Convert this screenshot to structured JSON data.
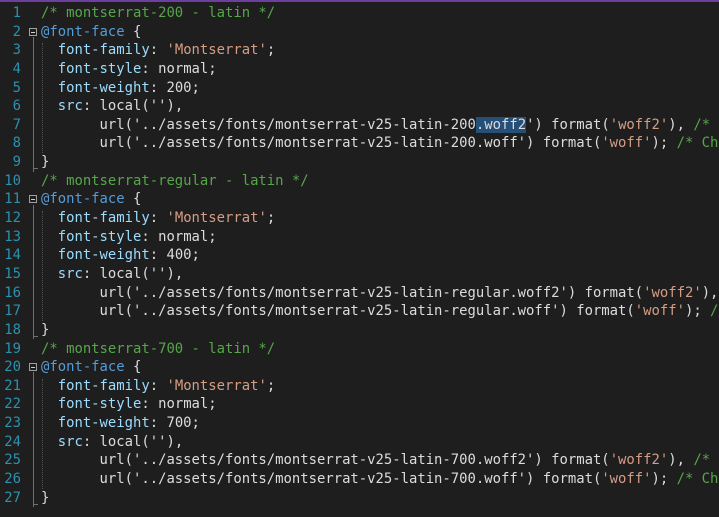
{
  "editor": {
    "accent_color": "#6c3f9e",
    "lines": [
      {
        "n": "1",
        "tokens": [
          [
            "c",
            "/* montserrat-200 - latin */"
          ]
        ]
      },
      {
        "n": "2",
        "fold": true,
        "tokens": [
          [
            "k",
            "@font-face"
          ],
          [
            "t",
            " {"
          ]
        ]
      },
      {
        "n": "3",
        "tokens": [
          [
            "t",
            "  "
          ],
          [
            "p",
            "font-family"
          ],
          [
            "t",
            ": "
          ],
          [
            "s",
            "'Montserrat'"
          ],
          [
            "t",
            ";"
          ]
        ]
      },
      {
        "n": "4",
        "tokens": [
          [
            "t",
            "  "
          ],
          [
            "p",
            "font-style"
          ],
          [
            "t",
            ": normal;"
          ]
        ]
      },
      {
        "n": "5",
        "tokens": [
          [
            "t",
            "  "
          ],
          [
            "p",
            "font-weight"
          ],
          [
            "t",
            ": 200;"
          ]
        ]
      },
      {
        "n": "6",
        "tokens": [
          [
            "t",
            "  "
          ],
          [
            "p",
            "src"
          ],
          [
            "t",
            ": local('"
          ],
          [
            "t",
            "'),"
          ]
        ]
      },
      {
        "n": "7",
        "tokens": [
          [
            "t",
            "       url('../assets/fonts/montserrat-v25-latin-200"
          ],
          [
            "caret",
            ""
          ],
          [
            "sel",
            ".woff2"
          ],
          [
            "t",
            "') format("
          ],
          [
            "s",
            "'woff2'"
          ],
          [
            "t",
            "), "
          ],
          [
            "c",
            "/*"
          ]
        ]
      },
      {
        "n": "8",
        "tokens": [
          [
            "t",
            "       url('../assets/fonts/montserrat-v25-latin-200.woff') format("
          ],
          [
            "s",
            "'woff'"
          ],
          [
            "t",
            "); "
          ],
          [
            "c",
            "/* Ch"
          ]
        ]
      },
      {
        "n": "9",
        "tokens": [
          [
            "t",
            "}"
          ]
        ]
      },
      {
        "n": "10",
        "tokens": [
          [
            "c",
            "/* montserrat-regular - latin */"
          ]
        ]
      },
      {
        "n": "11",
        "fold": true,
        "tokens": [
          [
            "k",
            "@font-face"
          ],
          [
            "t",
            " {"
          ]
        ]
      },
      {
        "n": "12",
        "tokens": [
          [
            "t",
            "  "
          ],
          [
            "p",
            "font-family"
          ],
          [
            "t",
            ": "
          ],
          [
            "s",
            "'Montserrat'"
          ],
          [
            "t",
            ";"
          ]
        ]
      },
      {
        "n": "13",
        "tokens": [
          [
            "t",
            "  "
          ],
          [
            "p",
            "font-style"
          ],
          [
            "t",
            ": normal;"
          ]
        ]
      },
      {
        "n": "14",
        "tokens": [
          [
            "t",
            "  "
          ],
          [
            "p",
            "font-weight"
          ],
          [
            "t",
            ": 400;"
          ]
        ]
      },
      {
        "n": "15",
        "tokens": [
          [
            "t",
            "  "
          ],
          [
            "p",
            "src"
          ],
          [
            "t",
            ": local('"
          ],
          [
            "t",
            "'),"
          ]
        ]
      },
      {
        "n": "16",
        "tokens": [
          [
            "t",
            "       url('../assets/fonts/montserrat-v25-latin-regular.woff2') format("
          ],
          [
            "s",
            "'woff2'"
          ],
          [
            "t",
            "),"
          ]
        ]
      },
      {
        "n": "17",
        "tokens": [
          [
            "t",
            "       url('../assets/fonts/montserrat-v25-latin-regular.woff') format("
          ],
          [
            "s",
            "'woff'"
          ],
          [
            "t",
            "); "
          ],
          [
            "c",
            "/"
          ]
        ]
      },
      {
        "n": "18",
        "tokens": [
          [
            "t",
            "}"
          ]
        ]
      },
      {
        "n": "19",
        "tokens": [
          [
            "c",
            "/* montserrat-700 - latin */"
          ]
        ]
      },
      {
        "n": "20",
        "fold": true,
        "tokens": [
          [
            "k",
            "@font-face"
          ],
          [
            "t",
            " {"
          ]
        ]
      },
      {
        "n": "21",
        "tokens": [
          [
            "t",
            "  "
          ],
          [
            "p",
            "font-family"
          ],
          [
            "t",
            ": "
          ],
          [
            "s",
            "'Montserrat'"
          ],
          [
            "t",
            ";"
          ]
        ]
      },
      {
        "n": "22",
        "tokens": [
          [
            "t",
            "  "
          ],
          [
            "p",
            "font-style"
          ],
          [
            "t",
            ": normal;"
          ]
        ]
      },
      {
        "n": "23",
        "tokens": [
          [
            "t",
            "  "
          ],
          [
            "p",
            "font-weight"
          ],
          [
            "t",
            ": 700;"
          ]
        ]
      },
      {
        "n": "24",
        "tokens": [
          [
            "t",
            "  "
          ],
          [
            "p",
            "src"
          ],
          [
            "t",
            ": local('"
          ],
          [
            "t",
            "'),"
          ]
        ]
      },
      {
        "n": "25",
        "tokens": [
          [
            "t",
            "       url('../assets/fonts/montserrat-v25-latin-700.woff2') format("
          ],
          [
            "s",
            "'woff2'"
          ],
          [
            "t",
            "), "
          ],
          [
            "c",
            "/*"
          ]
        ]
      },
      {
        "n": "26",
        "tokens": [
          [
            "t",
            "       url('../assets/fonts/montserrat-v25-latin-700.woff') format("
          ],
          [
            "s",
            "'woff'"
          ],
          [
            "t",
            "); "
          ],
          [
            "c",
            "/* Ch"
          ]
        ]
      },
      {
        "n": "27",
        "tokens": [
          [
            "t",
            "}"
          ]
        ]
      }
    ]
  }
}
